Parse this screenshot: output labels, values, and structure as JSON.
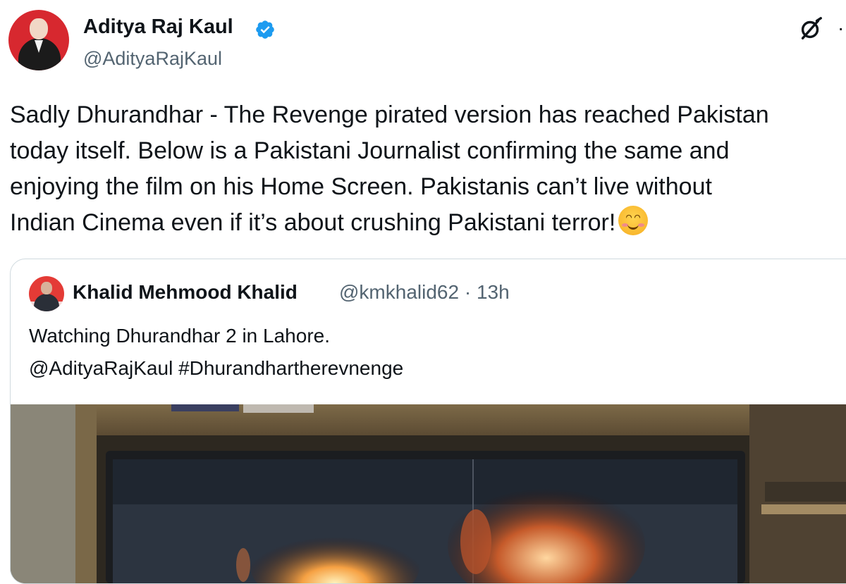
{
  "author": {
    "name": "Aditya Raj Kaul",
    "handle": "@AdityaRajKaul",
    "verified_color": "#1d9bf0",
    "avatar_bg": "#d7282f"
  },
  "header_icons": [
    "grok-icon",
    "more-icon"
  ],
  "more_label": "·",
  "tweet": {
    "text": "Sadly Dhurandhar - The Revenge pirated version has reached Pakistan\ntoday itself. Below is a Pakistani Journalist confirming the same and\nenjoying the film on his Home Screen. Pakistanis can’t live without\nIndian Cinema even if it’s about crushing Pakistani terror!",
    "emoji": "smiling-face-with-smiling-eyes"
  },
  "quoted_tweet": {
    "name": "Khalid Mehmood Khalid",
    "handle": "@kmkhalid62",
    "separator": "·",
    "time": "13h",
    "text": "Watching Dhurandhar 2 in Lahore.\n@AdityaRajKaul #Dhurandhartherevnenge",
    "media": "tv-screen-photo"
  },
  "colors": {
    "text": "#0f1419",
    "secondary": "#536471",
    "border": "#cfd9de",
    "accent": "#1d9bf0"
  }
}
